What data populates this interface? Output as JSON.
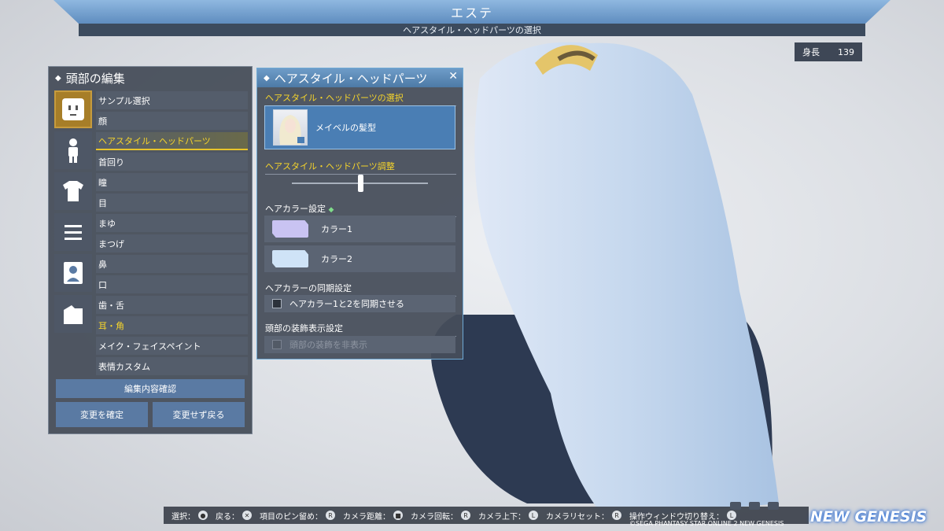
{
  "header": {
    "title": "エステ",
    "subtitle": "ヘアスタイル・ヘッドパーツの選択"
  },
  "height": {
    "label": "身長",
    "value": "139"
  },
  "left_panel": {
    "title": "頭部の編集",
    "category_icons": [
      "face-icon",
      "body-icon",
      "shirt-icon",
      "menu-lines-icon",
      "portrait-icon",
      "bag-icon"
    ],
    "menu_items": [
      "サンプル選択",
      "顔",
      "ヘアスタイル・ヘッドパーツ",
      "首回り",
      "瞳",
      "目",
      "まゆ",
      "まつげ",
      "鼻",
      "口",
      "歯・舌",
      "耳・角",
      "メイク・フェイスペイント",
      "表情カスタム"
    ],
    "selected_index": 2,
    "confirm_label": "編集内容確認",
    "apply_label": "変更を確定",
    "cancel_label": "変更せず戻る"
  },
  "right_panel": {
    "title": "ヘアスタイル・ヘッドパーツ",
    "select_section": "ヘアスタイル・ヘッドパーツの選択",
    "selected_hair": "メイベルの髪型",
    "adjust_section": "ヘアスタイル・ヘッドパーツ調整",
    "slider_value": 0.5,
    "color_section": "ヘアカラー設定",
    "color1_label": "カラー1",
    "color2_label": "カラー2",
    "color1": "#c9c3f2",
    "color2": "#cfe3f7",
    "sync_section": "ヘアカラーの同期設定",
    "sync_label": "ヘアカラー1と2を同期させる",
    "decor_section": "頭部の装飾表示設定",
    "decor_label": "頭部の装飾を非表示"
  },
  "footer": {
    "select": "選択：",
    "back": "戻る：",
    "pin": "項目のピン留め：",
    "camera_distance": "カメラ距離：",
    "camera_rotate": "カメラ回転：",
    "camera_updown": "カメラ上下：",
    "camera_reset": "カメラリセット：",
    "window_switch": "操作ウィンドウ切り替え：",
    "copyright": "©SEGA PHANTASY STAR ONLINE 2 NEW GENESIS",
    "logo": "NEW GENESIS"
  }
}
